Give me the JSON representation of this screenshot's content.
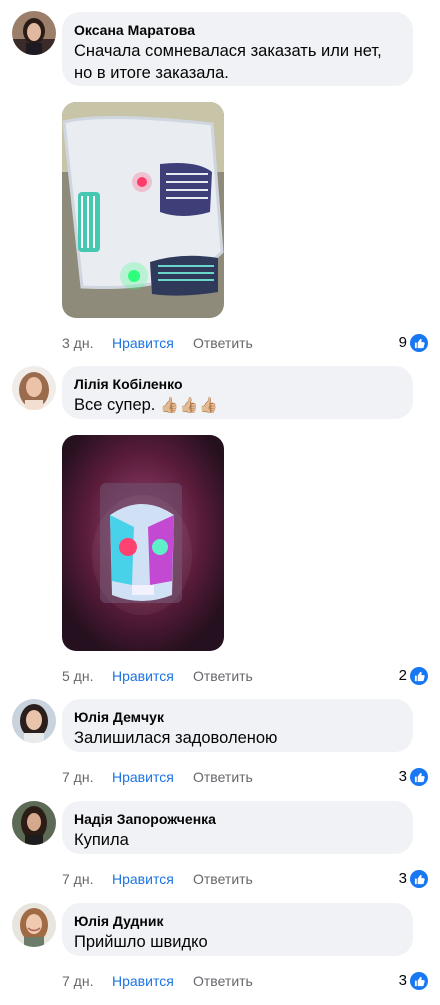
{
  "comments": [
    {
      "author": "Оксана Маратова",
      "text": "Сначала сомневалася заказать или нет, но в итоге заказала.",
      "time": "3 дн.",
      "like_label": "Нравится",
      "reply_label": "Ответить",
      "reactions": "9",
      "has_photo": true
    },
    {
      "author": "Лілія Кобіленко",
      "text": "Все супер.",
      "emoji": "👍🏼👍🏼👍🏼",
      "time": "5 дн.",
      "like_label": "Нравится",
      "reply_label": "Ответить",
      "reactions": "2",
      "has_photo": true
    },
    {
      "author": "Юлія Демчук",
      "text": "Залишилася задоволеною",
      "time": "7 дн.",
      "like_label": "Нравится",
      "reply_label": "Ответить",
      "reactions": "3",
      "has_photo": false
    },
    {
      "author": "Надія Запорожченка",
      "text": "Купила",
      "time": "7 дн.",
      "like_label": "Нравится",
      "reply_label": "Ответить",
      "reactions": "3",
      "has_photo": false
    },
    {
      "author": "Юлія Дудник",
      "text": "Прийшло швидко",
      "time": "7 дн.",
      "like_label": "Нравится",
      "reply_label": "Ответить",
      "reactions": "3",
      "has_photo": false
    }
  ],
  "colors": {
    "bubble": "#f0f2f5",
    "link": "#1b74e4",
    "muted": "#65676b",
    "like_badge": "#1877f2"
  },
  "icons": {
    "reaction": "thumbs-up-icon"
  }
}
